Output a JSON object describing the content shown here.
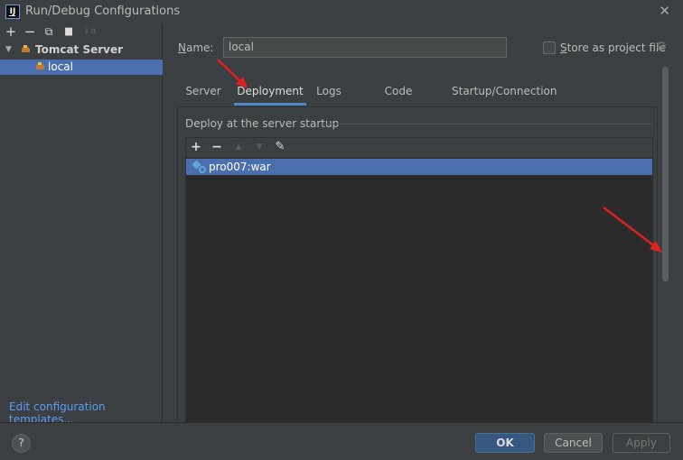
{
  "window": {
    "title": "Run/Debug Configurations",
    "app_icon_letter": "IJ"
  },
  "left_toolbar": {
    "add": "+",
    "remove": "−",
    "copy": "⧉",
    "folder": "▆",
    "sort": "↓a"
  },
  "tree": {
    "group_label": "Tomcat Server",
    "child_label": "local"
  },
  "edit_templates_link": "Edit configuration templates...",
  "name_field": {
    "label_prefix": "N",
    "label_rest": "ame:",
    "value": "local"
  },
  "store": {
    "label_prefix": "S",
    "label_rest": "tore as project file",
    "checked": false
  },
  "tabs": [
    {
      "label": "Server"
    },
    {
      "label": "Deployment"
    },
    {
      "label": "Logs"
    },
    {
      "label": "Code Coverage"
    },
    {
      "label": "Startup/Connection"
    }
  ],
  "active_tab": "Deployment",
  "deploy_section": {
    "title": "Deploy at the server startup",
    "items": [
      {
        "label": "pro007:war"
      }
    ]
  },
  "buttons": {
    "help": "?",
    "ok": "OK",
    "cancel": "Cancel",
    "apply": "Apply"
  },
  "colors": {
    "selection": "#4b6eaf",
    "ok_button": "#365880",
    "annotation_arrow": "#e02020"
  }
}
